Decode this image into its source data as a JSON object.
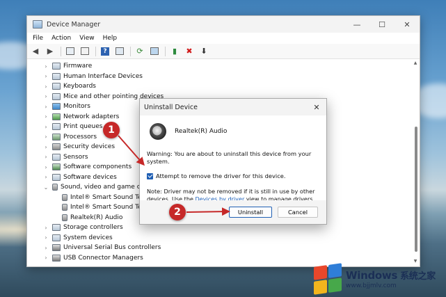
{
  "window": {
    "title": "Device Manager",
    "controls": {
      "minimize": "—",
      "maximize": "☐",
      "close": "✕"
    }
  },
  "menu": [
    "File",
    "Action",
    "View",
    "Help"
  ],
  "toolbar_icons": [
    "back-icon",
    "forward-icon",
    "show-hide-tree-icon",
    "properties-icon",
    "help-icon",
    "details-icon",
    "update-driver-icon",
    "monitor-icon",
    "enable-device-icon",
    "uninstall-icon",
    "download-icon"
  ],
  "tree": [
    {
      "label": "Firmware",
      "expanded": false,
      "icon": "firmware-icon"
    },
    {
      "label": "Human Interface Devices",
      "expanded": false,
      "icon": "hid-icon"
    },
    {
      "label": "Keyboards",
      "expanded": false,
      "icon": "keyboard-icon"
    },
    {
      "label": "Mice and other pointing devices",
      "expanded": false,
      "icon": "mouse-icon"
    },
    {
      "label": "Monitors",
      "expanded": false,
      "icon": "monitor-icon"
    },
    {
      "label": "Network adapters",
      "expanded": false,
      "icon": "network-icon"
    },
    {
      "label": "Print queues",
      "expanded": false,
      "icon": "printer-icon"
    },
    {
      "label": "Processors",
      "expanded": false,
      "icon": "processor-icon"
    },
    {
      "label": "Security devices",
      "expanded": false,
      "icon": "security-icon"
    },
    {
      "label": "Sensors",
      "expanded": false,
      "icon": "sensor-icon"
    },
    {
      "label": "Software components",
      "expanded": false,
      "icon": "software-icon"
    },
    {
      "label": "Software devices",
      "expanded": false,
      "icon": "software-device-icon"
    },
    {
      "label": "Sound, video and game co",
      "expanded": true,
      "icon": "sound-icon"
    },
    {
      "label": "Intel® Smart Sound Te",
      "child": true,
      "icon": "speaker-icon"
    },
    {
      "label": "Intel® Smart Sound Te",
      "child": true,
      "icon": "speaker-icon"
    },
    {
      "label": "Realtek(R) Audio",
      "child": true,
      "icon": "speaker-icon"
    },
    {
      "label": "Storage controllers",
      "expanded": false,
      "icon": "storage-icon"
    },
    {
      "label": "System devices",
      "expanded": false,
      "icon": "system-icon"
    },
    {
      "label": "Universal Serial Bus controllers",
      "expanded": false,
      "icon": "usb-icon"
    },
    {
      "label": "USB Connector Managers",
      "expanded": false,
      "icon": "usb-connector-icon"
    }
  ],
  "dialog": {
    "title": "Uninstall Device",
    "close": "✕",
    "device_name": "Realtek(R) Audio",
    "warning": "Warning: You are about to uninstall this device from your system.",
    "checkbox_label": "Attempt to remove the driver for this device.",
    "checkbox_checked": true,
    "note_before": "Note: Driver may not be removed if it is still in use by other devices. Use the ",
    "note_link": "Devices by driver",
    "note_after": " view to manage drivers separately.",
    "uninstall_label": "Uninstall",
    "cancel_label": "Cancel"
  },
  "annotations": {
    "step1": "1",
    "step2": "2",
    "color": "#c62828"
  },
  "watermark": {
    "brand": "Windows",
    "brand_cn": "系统之家",
    "url": "www.bjjmlv.com",
    "logo_colors": [
      "#e8472b",
      "#2f7ed8",
      "#f2b51d",
      "#47a84a"
    ]
  }
}
